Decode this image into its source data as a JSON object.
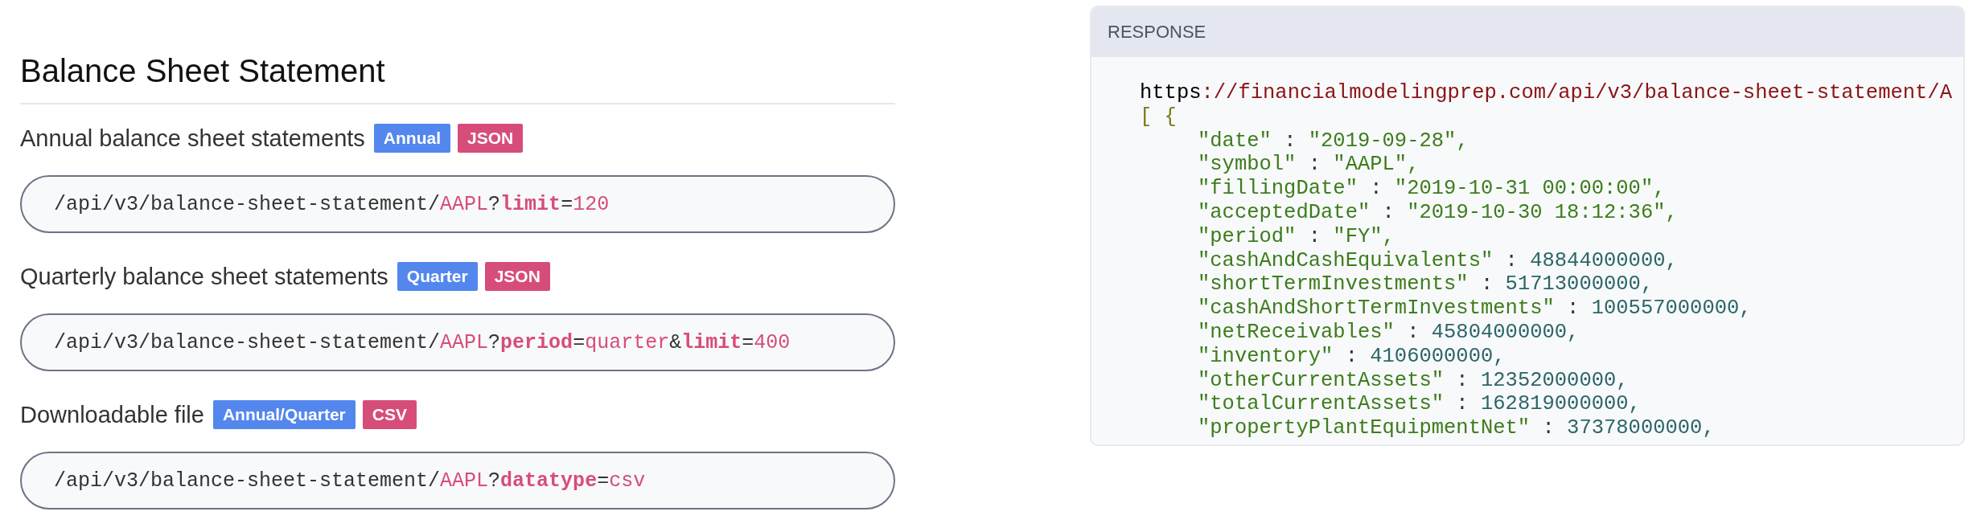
{
  "heading": "Balance Sheet Statement",
  "endpoints": [
    {
      "title": "Annual balance sheet statements",
      "badges": [
        {
          "label": "Annual",
          "kind": "period"
        },
        {
          "label": "JSON",
          "kind": "format"
        }
      ],
      "segments": [
        {
          "text": "/api/v3/balance-sheet-statement/",
          "kind": "path"
        },
        {
          "text": "AAPL",
          "kind": "value"
        },
        {
          "text": "?",
          "kind": "sep"
        },
        {
          "text": "limit",
          "kind": "param"
        },
        {
          "text": "=",
          "kind": "sep"
        },
        {
          "text": "120",
          "kind": "value"
        }
      ]
    },
    {
      "title": "Quarterly balance sheet statements",
      "badges": [
        {
          "label": "Quarter",
          "kind": "period"
        },
        {
          "label": "JSON",
          "kind": "format"
        }
      ],
      "segments": [
        {
          "text": "/api/v3/balance-sheet-statement/",
          "kind": "path"
        },
        {
          "text": "AAPL",
          "kind": "value"
        },
        {
          "text": "?",
          "kind": "sep"
        },
        {
          "text": "period",
          "kind": "param"
        },
        {
          "text": "=",
          "kind": "sep"
        },
        {
          "text": "quarter",
          "kind": "value"
        },
        {
          "text": "&",
          "kind": "sep"
        },
        {
          "text": "limit",
          "kind": "param"
        },
        {
          "text": "=",
          "kind": "sep"
        },
        {
          "text": "400",
          "kind": "value"
        }
      ]
    },
    {
      "title": "Downloadable file",
      "badges": [
        {
          "label": "Annual/Quarter",
          "kind": "period"
        },
        {
          "label": "CSV",
          "kind": "format"
        }
      ],
      "segments": [
        {
          "text": "/api/v3/balance-sheet-statement/",
          "kind": "path"
        },
        {
          "text": "AAPL",
          "kind": "value"
        },
        {
          "text": "?",
          "kind": "sep"
        },
        {
          "text": "datatype",
          "kind": "param"
        },
        {
          "text": "=",
          "kind": "sep"
        },
        {
          "text": "csv",
          "kind": "value"
        }
      ]
    }
  ],
  "response": {
    "title": "RESPONSE",
    "url_scheme": "https",
    "url_rest": "://financialmodelingprep.com/api/v3/balance-sheet-statement/A",
    "open": "[ {",
    "fields": [
      {
        "key": "\"date\"",
        "colon": " : ",
        "value": "\"2019-09-28\",",
        "kind": "string"
      },
      {
        "key": "\"symbol\"",
        "colon": " : ",
        "value": "\"AAPL\",",
        "kind": "string"
      },
      {
        "key": "\"fillingDate\"",
        "colon": " : ",
        "value": "\"2019-10-31 00:00:00\",",
        "kind": "string"
      },
      {
        "key": "\"acceptedDate\"",
        "colon": " : ",
        "value": "\"2019-10-30 18:12:36\",",
        "kind": "string"
      },
      {
        "key": "\"period\"",
        "colon": " : ",
        "value": "\"FY\",",
        "kind": "string"
      },
      {
        "key": "\"cashAndCashEquivalents\"",
        "colon": " : ",
        "value": "48844000000,",
        "kind": "number"
      },
      {
        "key": "\"shortTermInvestments\"",
        "colon": " : ",
        "value": "51713000000,",
        "kind": "number"
      },
      {
        "key": "\"cashAndShortTermInvestments\"",
        "colon": " : ",
        "value": "100557000000,",
        "kind": "number"
      },
      {
        "key": "\"netReceivables\"",
        "colon": " : ",
        "value": "45804000000,",
        "kind": "number"
      },
      {
        "key": "\"inventory\"",
        "colon": " : ",
        "value": "4106000000,",
        "kind": "number"
      },
      {
        "key": "\"otherCurrentAssets\"",
        "colon": " : ",
        "value": "12352000000,",
        "kind": "number"
      },
      {
        "key": "\"totalCurrentAssets\"",
        "colon": " : ",
        "value": "162819000000,",
        "kind": "number"
      },
      {
        "key": "\"propertyPlantEquipmentNet\"",
        "colon": " : ",
        "value": "37378000000,",
        "kind": "number"
      }
    ]
  }
}
